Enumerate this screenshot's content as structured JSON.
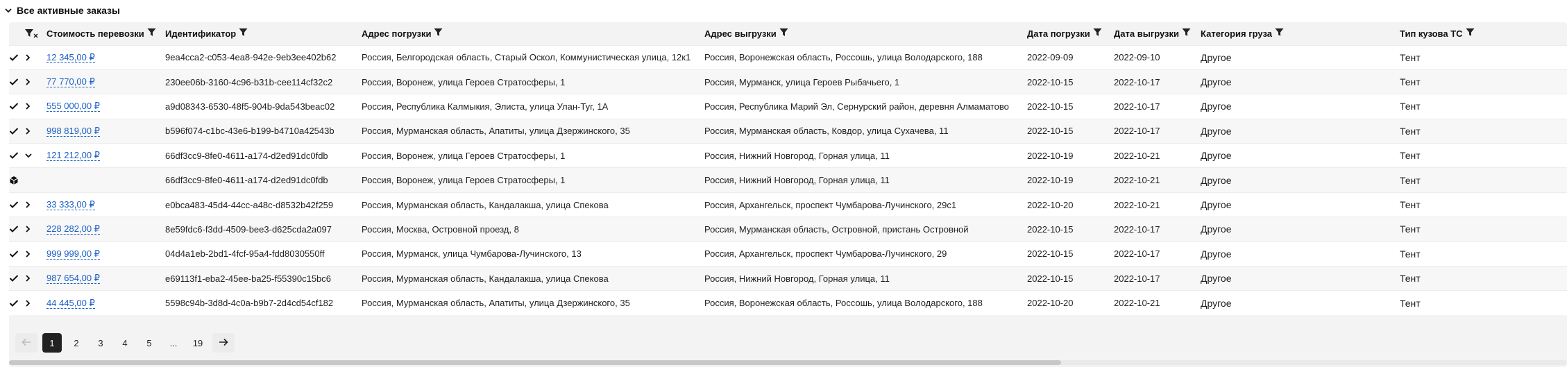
{
  "section": {
    "title": "Все активные заказы"
  },
  "columns": {
    "cost": "Стоимость перевозки",
    "id": "Идентификатор",
    "load_address": "Адрес погрузки",
    "unload_address": "Адрес выгрузки",
    "load_date": "Дата погрузки",
    "unload_date": "Дата выгрузки",
    "cargo_category": "Категория груза",
    "body_type": "Тип кузова ТС"
  },
  "rows": [
    {
      "status": "check",
      "expand": "chevron-right",
      "cost": "12 345,00 ₽",
      "id": "9ea4cca2-c053-4ea8-942e-9eb3ee402b62",
      "load_address": "Россия, Белгородская область, Старый Оскол, Коммунистическая улица, 12к1",
      "unload_address": "Россия, Воронежская область, Россошь, улица Володарского, 188",
      "load_date": "2022-09-09",
      "unload_date": "2022-09-10",
      "cargo_category": "Другое",
      "body_type": "Тент"
    },
    {
      "status": "check",
      "expand": "chevron-right",
      "cost": "77 770,00 ₽",
      "id": "230ee06b-3160-4c96-b31b-cee114cf32c2",
      "load_address": "Россия, Воронеж, улица Героев Стратосферы, 1",
      "unload_address": "Россия, Мурманск, улица Героев Рыбачьего, 1",
      "load_date": "2022-10-15",
      "unload_date": "2022-10-17",
      "cargo_category": "Другое",
      "body_type": "Тент"
    },
    {
      "status": "check",
      "expand": "chevron-right",
      "cost": "555 000,00 ₽",
      "id": "a9d08343-6530-48f5-904b-9da543beac02",
      "load_address": "Россия, Республика Калмыкия, Элиста, улица Улан-Туг, 1А",
      "unload_address": "Россия, Республика Марий Эл, Сернурский район, деревня Алмаматово",
      "load_date": "2022-10-15",
      "unload_date": "2022-10-17",
      "cargo_category": "Другое",
      "body_type": "Тент"
    },
    {
      "status": "check",
      "expand": "chevron-right",
      "cost": "998 819,00 ₽",
      "id": "b596f074-c1bc-43e6-b199-b4710a42543b",
      "load_address": "Россия, Мурманская область, Апатиты, улица Дзержинского, 35",
      "unload_address": "Россия, Мурманская область, Ковдор, улица Сухачева, 11",
      "load_date": "2022-10-15",
      "unload_date": "2022-10-17",
      "cargo_category": "Другое",
      "body_type": "Тент"
    },
    {
      "status": "check",
      "expand": "chevron-down",
      "cost": "121 212,00 ₽",
      "id": "66df3cc9-8fe0-4611-a174-d2ed91dc0fdb",
      "load_address": "Россия, Воронеж, улица Героев Стратосферы, 1",
      "unload_address": "Россия, Нижний Новгород, Горная улица, 11",
      "load_date": "2022-10-19",
      "unload_date": "2022-10-21",
      "cargo_category": "Другое",
      "body_type": "Тент"
    },
    {
      "status": "box",
      "expand": "",
      "cost": "",
      "id": "66df3cc9-8fe0-4611-a174-d2ed91dc0fdb",
      "load_address": "Россия, Воронеж, улица Героев Стратосферы, 1",
      "unload_address": "Россия, Нижний Новгород, Горная улица, 11",
      "load_date": "2022-10-19",
      "unload_date": "2022-10-21",
      "cargo_category": "Другое",
      "body_type": "Тент"
    },
    {
      "status": "check",
      "expand": "chevron-right",
      "cost": "33 333,00 ₽",
      "id": "e0bca483-45d4-44cc-a48c-d8532b42f259",
      "load_address": "Россия, Мурманская область, Кандалакша, улица Спекова",
      "unload_address": "Россия, Архангельск, проспект Чумбарова-Лучинского, 29с1",
      "load_date": "2022-10-20",
      "unload_date": "2022-10-21",
      "cargo_category": "Другое",
      "body_type": "Тент"
    },
    {
      "status": "check",
      "expand": "chevron-right",
      "cost": "228 282,00 ₽",
      "id": "8e59fdc6-f3dd-4509-bee3-d625cda2a097",
      "load_address": "Россия, Москва, Островной проезд, 8",
      "unload_address": "Россия, Мурманская область, Островной, пристань Островной",
      "load_date": "2022-10-15",
      "unload_date": "2022-10-17",
      "cargo_category": "Другое",
      "body_type": "Тент"
    },
    {
      "status": "check",
      "expand": "chevron-right",
      "cost": "999 999,00 ₽",
      "id": "04d4a1eb-2bd1-4fcf-95a4-fdd8030550ff",
      "load_address": "Россия, Мурманск, улица Чумбарова-Лучинского, 13",
      "unload_address": "Россия, Архангельск, проспект Чумбарова-Лучинского, 29",
      "load_date": "2022-10-15",
      "unload_date": "2022-10-17",
      "cargo_category": "Другое",
      "body_type": "Тент"
    },
    {
      "status": "check",
      "expand": "chevron-right",
      "cost": "987 654,00 ₽",
      "id": "e69113f1-eba2-45ee-ba25-f55390c15bc6",
      "load_address": "Россия, Мурманская область, Кандалакша, улица Спекова",
      "unload_address": "Россия, Нижний Новгород, Горная улица, 11",
      "load_date": "2022-10-15",
      "unload_date": "2022-10-17",
      "cargo_category": "Другое",
      "body_type": "Тент"
    },
    {
      "status": "check",
      "expand": "chevron-right",
      "cost": "44 445,00 ₽",
      "id": "5598c94b-3d8d-4c0a-b9b7-2d4cd54cf182",
      "load_address": "Россия, Мурманская область, Апатиты, улица Дзержинского, 35",
      "unload_address": "Россия, Воронежская область, Россошь, улица Володарского, 188",
      "load_date": "2022-10-20",
      "unload_date": "2022-10-21",
      "cargo_category": "Другое",
      "body_type": "Тент"
    }
  ],
  "pagination": {
    "prev_icon": "arrow-left-icon",
    "next_icon": "arrow-right-icon",
    "pages": [
      "1",
      "2",
      "3",
      "4",
      "5",
      "...",
      "19"
    ],
    "current": "1"
  }
}
